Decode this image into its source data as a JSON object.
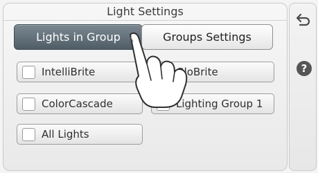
{
  "title": "Light Settings",
  "tabs": [
    {
      "label": "Lights in Group",
      "active": true
    },
    {
      "label": "Groups Settings",
      "active": false
    }
  ],
  "lights": [
    {
      "label": "IntelliBrite"
    },
    {
      "label": "GloBrite"
    },
    {
      "label": "ColorCascade"
    },
    {
      "label": "Lighting Group 1"
    },
    {
      "label": "All Lights"
    }
  ],
  "side_buttons": {
    "back_icon": "back-arrow-icon",
    "help_icon": "help-icon",
    "help_label": "?"
  },
  "colors": {
    "active_tab": "#5f6d76",
    "panel": "#efefef"
  }
}
